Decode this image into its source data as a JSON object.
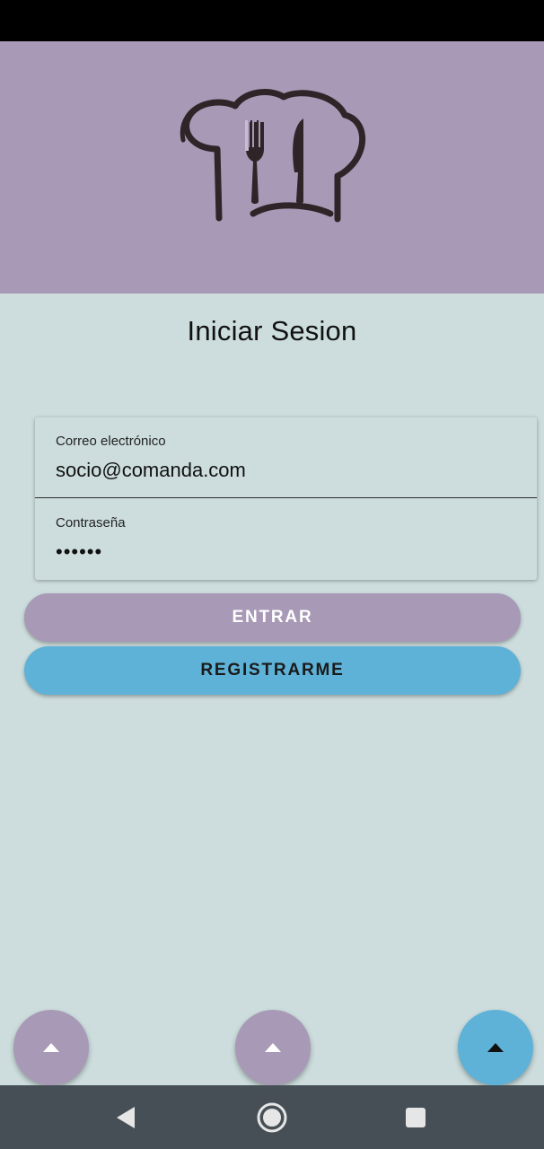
{
  "header": {
    "logo_icon": "chef-hat-fork-knife-icon",
    "background_color": "#a899b6"
  },
  "login": {
    "title": "Iniciar Sesion",
    "email": {
      "label": "Correo electrónico",
      "value": "socio@comanda.com"
    },
    "password": {
      "label": "Contraseña",
      "masked_value": "••••••"
    },
    "buttons": {
      "enter_label": "ENTRAR",
      "register_label": "REGISTRARME"
    }
  },
  "fabs": [
    {
      "icon": "caret-up-icon",
      "color": "#a899b6"
    },
    {
      "icon": "caret-up-icon",
      "color": "#a899b6"
    },
    {
      "icon": "caret-up-icon",
      "color": "#5eb2d7"
    }
  ],
  "system_nav": {
    "back_icon": "back-triangle-icon",
    "home_icon": "home-circle-icon",
    "recents_icon": "recents-square-icon"
  },
  "colors": {
    "background": "#cddddd",
    "primary_purple": "#a899b6",
    "accent_blue": "#5eb2d7",
    "nav_bar": "#464f56"
  }
}
